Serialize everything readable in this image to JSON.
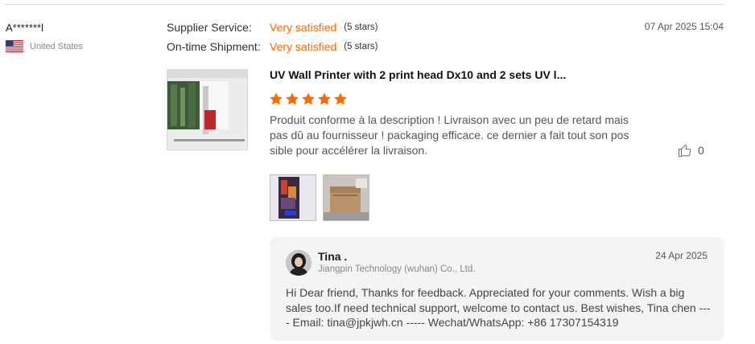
{
  "reviewer": {
    "name": "A*******l",
    "country": "United States",
    "flag_icon": "us-flag-icon"
  },
  "ratings": [
    {
      "label": "Supplier Service:",
      "value": "Very satisfied",
      "count": "(5 stars)"
    },
    {
      "label": "On-time Shipment:",
      "value": "Very satisfied",
      "count": "(5 stars)"
    }
  ],
  "review_date": "07 Apr 2025 15:04",
  "product": {
    "title": "UV Wall Printer with 2 print head Dx10 and 2 sets UV l...",
    "rating": 5
  },
  "review_text": "Produit conforme à la description ! Livraison avec un peu de retard mais pas dû au fournisseur ! packaging efficace.  ce dernier a fait tout son possible pour accélérer la livraison.",
  "likes": "0",
  "reply": {
    "name": "Tina .",
    "company": "Jiangpin Technology (wuhan) Co., Ltd.",
    "date": "24 Apr 2025",
    "text": "Hi Dear friend, Thanks for feedback. Appreciated for your comments. Wish a big sales too.If need technical support, welcome to contact us. Best wishes, Tina chen ---- Email: tina@jpkjwh.cn ----- Wechat/WhatsApp: +86 17307154319"
  },
  "colors": {
    "accent": "#ff6a00",
    "reply_bg": "#f4f4f4"
  }
}
